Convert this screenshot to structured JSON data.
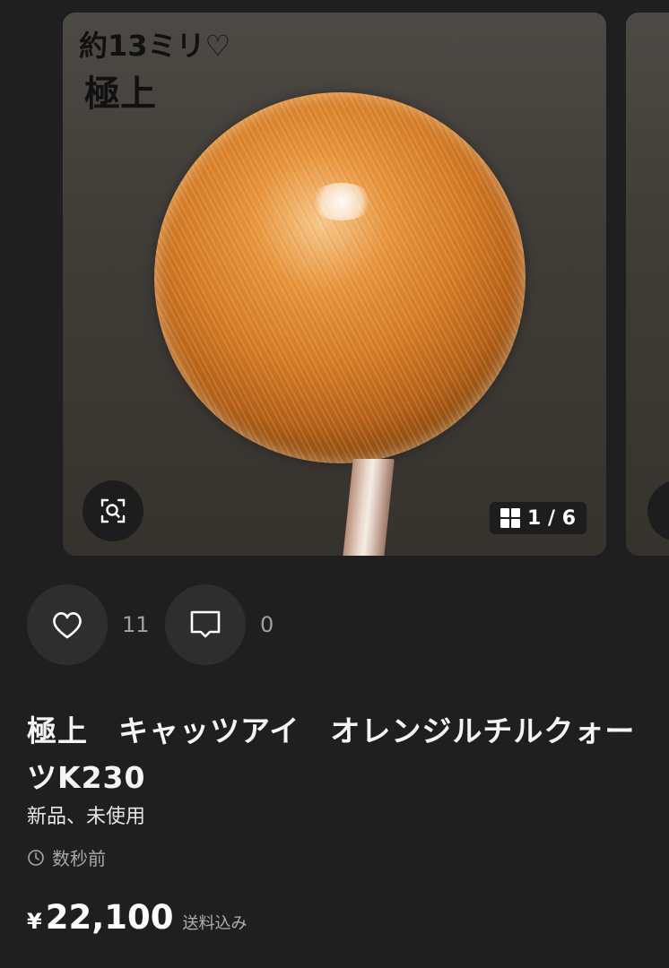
{
  "carousel": {
    "overlay_size": "約13ミリ♡",
    "overlay_grade": "極上",
    "counter": "1 / 6"
  },
  "actions": {
    "like_count": "11",
    "comment_count": "0"
  },
  "listing": {
    "title": "極上　キャッツアイ　オレンジルチルクォーツK230",
    "condition": "新品、未使用",
    "posted": "数秒前",
    "currency": "¥",
    "price": "22,100",
    "shipping_note": "送料込み"
  },
  "colors": {
    "background": "#1f1f1f",
    "button_bg": "#2e2e2e"
  },
  "icons": [
    "zoom-search-icon",
    "grid-icon",
    "heart-icon",
    "comment-icon",
    "clock-icon"
  ]
}
